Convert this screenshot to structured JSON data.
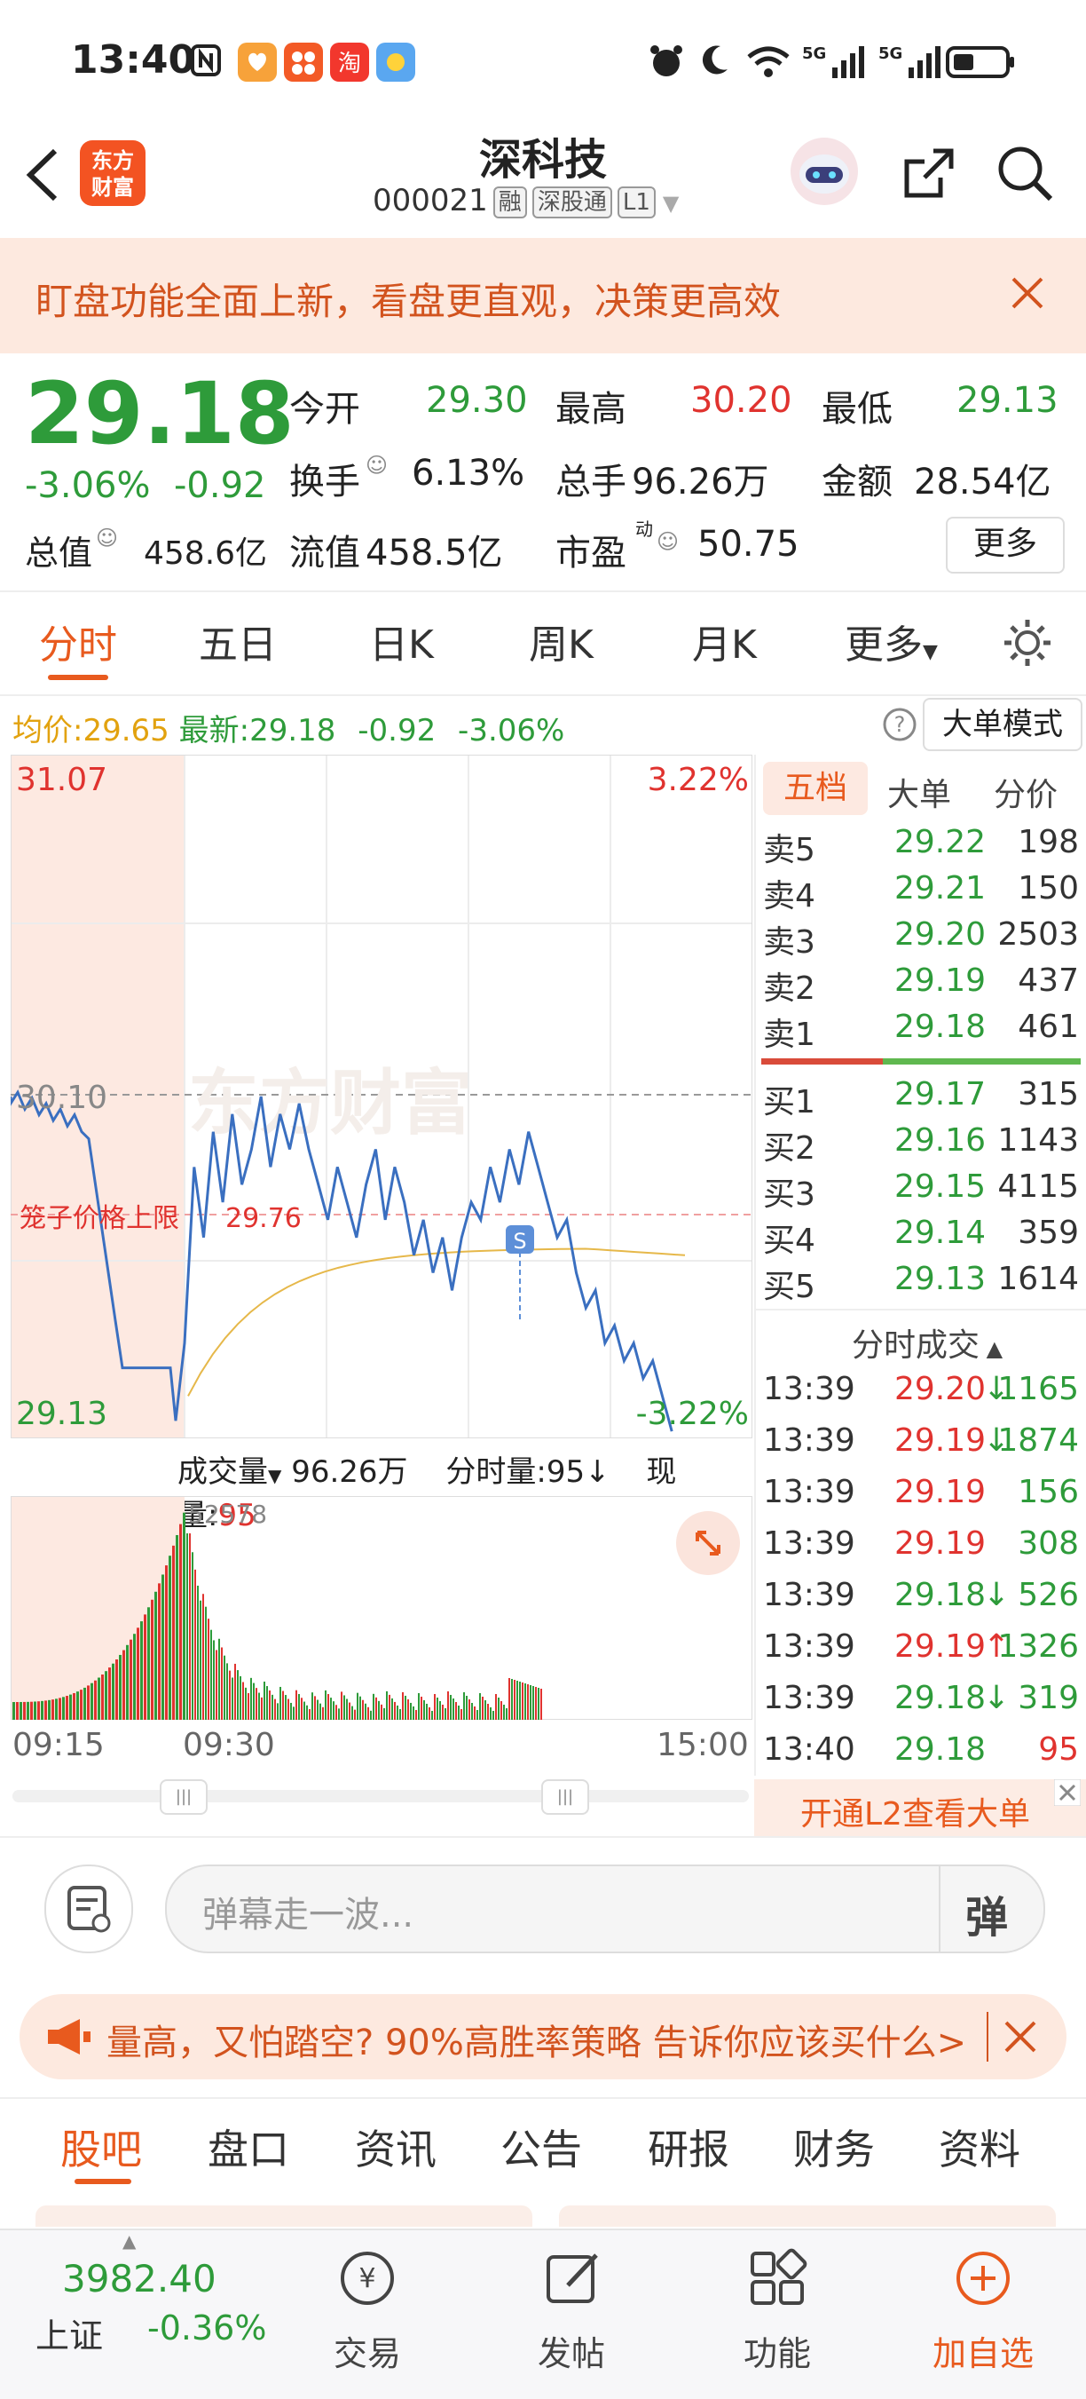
{
  "status": {
    "time": "13:40",
    "sig1": "5G",
    "sig2": "5G"
  },
  "header": {
    "logo_line1": "东方",
    "logo_line2": "财富",
    "title": "深科技",
    "code": "000021",
    "tags": [
      "融",
      "深股通",
      "L1"
    ]
  },
  "banner": {
    "text": "盯盘功能全面上新，看盘更直观，决策更高效"
  },
  "quote": {
    "price": "29.18",
    "change_pct": "-3.06%",
    "change": "-0.92",
    "open_label": "今开",
    "open": "29.30",
    "high_label": "最高",
    "high": "30.20",
    "low_label": "最低",
    "low": "29.13",
    "turnover_label": "换手",
    "turnover": "6.13%",
    "volume_label": "总手",
    "volume": "96.26万",
    "amount_label": "金额",
    "amount": "28.54亿",
    "mcap_label": "总值",
    "mcap": "458.6亿",
    "float_label": "流值",
    "float": "458.5亿",
    "pe_label": "市盈",
    "pe_sup": "动",
    "pe": "50.75",
    "more": "更多"
  },
  "tabs": [
    "分时",
    "五日",
    "日K",
    "周K",
    "月K",
    "更多"
  ],
  "chart": {
    "avg_label": "均价:",
    "avg": "29.65",
    "latest_label": "最新:",
    "latest": "29.18",
    "latest_chg": "-0.92",
    "latest_pct": "-3.06%",
    "mode": "大单模式",
    "y_top": "31.07",
    "y_mid": "30.10",
    "y_bot": "29.13",
    "pct_top": "3.22%",
    "pct_bot": "-3.22%",
    "cage_label": "笼子价格上限",
    "cage_val": "29.76",
    "watermark": "东方财富",
    "marker": "S"
  },
  "volume": {
    "label": "成交量",
    "total": "96.26万",
    "tick_label": "分时量:95↓",
    "now_label": "现量:",
    "now": "95",
    "max": "52578",
    "x_start": "09:15",
    "x_open": "09:30",
    "x_end": "15:00"
  },
  "orderbook": {
    "tabs": [
      "五档",
      "大单",
      "分价"
    ],
    "asks": [
      {
        "label": "卖5",
        "price": "29.22",
        "vol": "198"
      },
      {
        "label": "卖4",
        "price": "29.21",
        "vol": "150"
      },
      {
        "label": "卖3",
        "price": "29.20",
        "vol": "2503"
      },
      {
        "label": "卖2",
        "price": "29.19",
        "vol": "437"
      },
      {
        "label": "卖1",
        "price": "29.18",
        "vol": "461"
      }
    ],
    "bids": [
      {
        "label": "买1",
        "price": "29.17",
        "vol": "315"
      },
      {
        "label": "买2",
        "price": "29.16",
        "vol": "1143"
      },
      {
        "label": "买3",
        "price": "29.15",
        "vol": "4115"
      },
      {
        "label": "买4",
        "price": "29.14",
        "vol": "359"
      },
      {
        "label": "买5",
        "price": "29.13",
        "vol": "1614"
      }
    ],
    "ticks_title": "分时成交",
    "ticks": [
      {
        "time": "13:39",
        "price": "29.20",
        "dir": "↓",
        "vol": "1165"
      },
      {
        "time": "13:39",
        "price": "29.19",
        "dir": "↓",
        "vol": "1874"
      },
      {
        "time": "13:39",
        "price": "29.19",
        "dir": "",
        "vol": "156"
      },
      {
        "time": "13:39",
        "price": "29.19",
        "dir": "",
        "vol": "308"
      },
      {
        "time": "13:39",
        "price": "29.18",
        "dir": "↓",
        "vol": "526"
      },
      {
        "time": "13:39",
        "price": "29.19",
        "dir": "↑",
        "vol": "1326"
      },
      {
        "time": "13:39",
        "price": "29.18",
        "dir": "↓",
        "vol": "319"
      },
      {
        "time": "13:40",
        "price": "29.18",
        "dir": "",
        "vol": "95"
      }
    ],
    "l2": "开通L2查看大单"
  },
  "danmu": {
    "placeholder": "弹幕走一波...",
    "btn": "弹"
  },
  "ad": {
    "text": "量高，又怕踏空? 90%高胜率策略 告诉你应该买什么>"
  },
  "navtabs": [
    "股吧",
    "盘口",
    "资讯",
    "公告",
    "研报",
    "财务",
    "资料"
  ],
  "bottom": {
    "index_value": "3982.40",
    "index_name": "上证",
    "index_chg": "-0.36%",
    "items": [
      "交易",
      "发帖",
      "功能",
      "加自选"
    ]
  }
}
